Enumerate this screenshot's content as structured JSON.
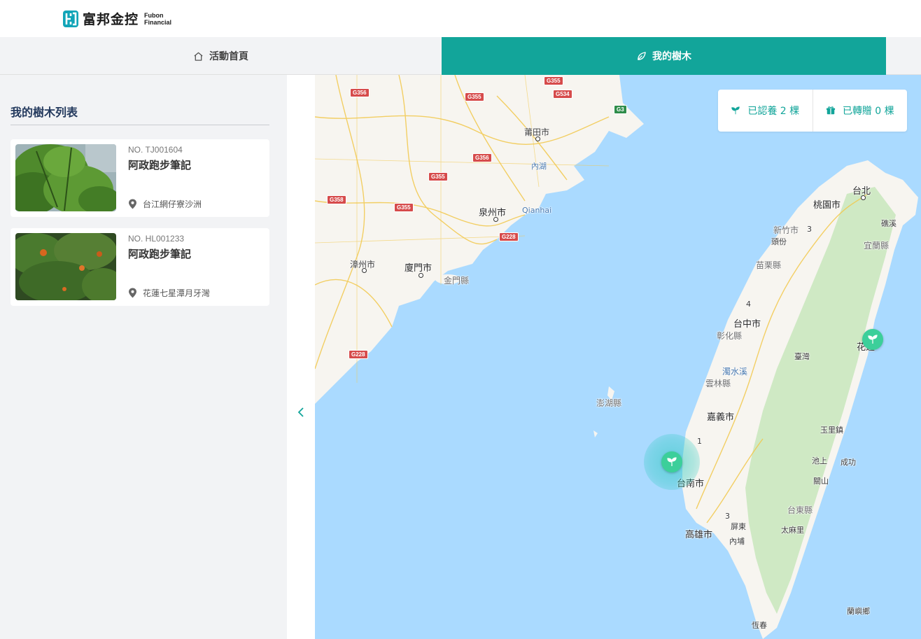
{
  "brand": {
    "name_zh": "富邦金控",
    "name_en_line1": "Fubon",
    "name_en_line2": "Financial",
    "icon": "fubon-logo-icon"
  },
  "tabs": [
    {
      "label": "活動首頁",
      "icon": "home-icon",
      "active": false
    },
    {
      "label": "我的樹木",
      "icon": "leaf-icon",
      "active": true
    }
  ],
  "colors": {
    "accent": "#12a59a",
    "marker": "#3ccf9a",
    "sea": "#aadaff",
    "land": "#f7f5f0",
    "forest": "#cfe9c4",
    "title": "#243a5e"
  },
  "sidebar": {
    "title": "我的樹木列表",
    "trees": [
      {
        "no": "NO. TJ001604",
        "name": "阿政跑步筆記",
        "location": "台江網仔寮沙洲",
        "location_icon": "location-pin-icon"
      },
      {
        "no": "NO. HL001233",
        "name": "阿政跑步筆記",
        "location": "花蓮七星潭月牙灣",
        "location_icon": "location-pin-icon"
      }
    ],
    "collapse_icon": "chevron-left-icon"
  },
  "stats": {
    "adopted": {
      "label": "已認養 2 棵",
      "icon": "sprout-icon"
    },
    "gifted": {
      "label": "已轉贈 0 棵",
      "icon": "gift-icon"
    }
  },
  "map": {
    "labels": {
      "putian": "莆田市",
      "quanzhou": "泉州市",
      "qianhai": "Qianhai",
      "zhangzhou": "漳州市",
      "xiamen": "廈門市",
      "kinmen": "金門縣",
      "neihu": "內湖",
      "penghu": "澎湖縣",
      "taipei": "台北",
      "taoyuan": "桃園市",
      "hsinchu": "新竹市",
      "toufen": "頭份",
      "keelung": "礁溪",
      "yilan": "宜蘭縣",
      "miaoli": "苗栗縣",
      "taichung": "台中市",
      "changhua": "彰化縣",
      "taiwan": "臺灣",
      "hualien": "花蓮",
      "zhuoshui": "濁水溪",
      "yunlin": "雲林縣",
      "chiayi": "嘉義市",
      "yuli": "玉里鎮",
      "chishang": "池上",
      "chenggong": "成功",
      "guanshan": "關山",
      "tainan": "台南市",
      "taitung": "台東縣",
      "kaohsiung": "高雄市",
      "pingtung": "屏東",
      "neipu": "內埔",
      "taimali": "太麻里",
      "lanyu": "蘭嶼鄉",
      "hengchun": "恆春"
    },
    "shields": [
      "G356",
      "G355",
      "G355",
      "G534",
      "G3",
      "G356",
      "G355",
      "G358",
      "G355",
      "G228",
      "G228"
    ],
    "route_numbers": [
      "3",
      "4",
      "1",
      "3"
    ],
    "tree_markers": [
      {
        "name": "台江網仔寮沙洲",
        "icon": "sprout-icon",
        "highlighted": true
      },
      {
        "name": "花蓮七星潭月牙灣",
        "icon": "sprout-icon",
        "highlighted": false
      }
    ]
  }
}
